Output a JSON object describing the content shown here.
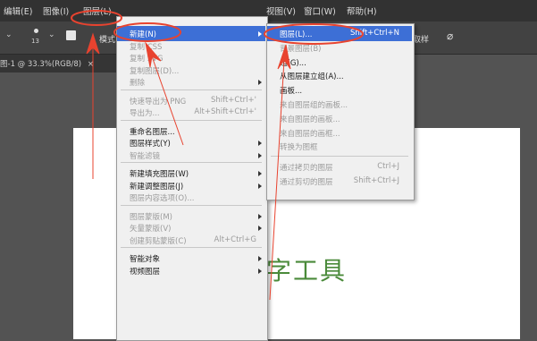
{
  "menubar": {
    "left_items": [
      "编辑(E)",
      "图像(I)",
      "图层(L)"
    ],
    "right_items": [
      "视图(V)",
      "窗口(W)",
      "帮助(H)"
    ]
  },
  "options": {
    "brush_size": "13",
    "mode_label": "模式",
    "right_label": "取样"
  },
  "doc_tab": {
    "label": "图-1 @ 33.3%(RGB/8)",
    "close": "×"
  },
  "canvas_text": "字工具",
  "layer_menu": [
    {
      "label": "新建(N)",
      "shortcut": "",
      "submenu": true,
      "state": "highlight"
    },
    {
      "label": "复制 CSS",
      "shortcut": "",
      "submenu": false,
      "state": "disabled"
    },
    {
      "label": "复制 SVG",
      "shortcut": "",
      "submenu": false,
      "state": "disabled"
    },
    {
      "label": "复制图层(D)...",
      "shortcut": "",
      "submenu": false,
      "state": "disabled"
    },
    {
      "label": "删除",
      "shortcut": "",
      "submenu": true,
      "state": "disabled"
    },
    {
      "sep": true
    },
    {
      "label": "快速导出为 PNG",
      "shortcut": "Shift+Ctrl+'",
      "submenu": false,
      "state": "disabled"
    },
    {
      "label": "导出为...",
      "shortcut": "Alt+Shift+Ctrl+'",
      "submenu": false,
      "state": "disabled"
    },
    {
      "sep": true
    },
    {
      "label": "重命名图层...",
      "shortcut": "",
      "submenu": false,
      "state": "normal"
    },
    {
      "label": "图层样式(Y)",
      "shortcut": "",
      "submenu": true,
      "state": "normal"
    },
    {
      "label": "智能滤镜",
      "shortcut": "",
      "submenu": true,
      "state": "disabled"
    },
    {
      "sep": true
    },
    {
      "label": "新建填充图层(W)",
      "shortcut": "",
      "submenu": true,
      "state": "normal"
    },
    {
      "label": "新建调整图层(J)",
      "shortcut": "",
      "submenu": true,
      "state": "normal"
    },
    {
      "label": "图层内容选项(O)...",
      "shortcut": "",
      "submenu": false,
      "state": "disabled"
    },
    {
      "sep": true
    },
    {
      "label": "图层蒙版(M)",
      "shortcut": "",
      "submenu": true,
      "state": "disabled"
    },
    {
      "label": "矢量蒙版(V)",
      "shortcut": "",
      "submenu": true,
      "state": "disabled"
    },
    {
      "label": "创建剪贴蒙版(C)",
      "shortcut": "Alt+Ctrl+G",
      "submenu": false,
      "state": "disabled"
    },
    {
      "sep": true
    },
    {
      "label": "智能对象",
      "shortcut": "",
      "submenu": true,
      "state": "normal"
    },
    {
      "label": "视频图层",
      "shortcut": "",
      "submenu": true,
      "state": "normal"
    }
  ],
  "new_submenu": [
    {
      "label": "图层(L)...",
      "shortcut": "Shift+Ctrl+N",
      "state": "highlight"
    },
    {
      "label": "背景图层(B)",
      "shortcut": "",
      "state": "disabled"
    },
    {
      "label": "组(G)...",
      "shortcut": "",
      "state": "normal"
    },
    {
      "label": "从图层建立组(A)...",
      "shortcut": "",
      "state": "normal"
    },
    {
      "label": "画板...",
      "shortcut": "",
      "state": "normal"
    },
    {
      "label": "来自图层组的画板...",
      "shortcut": "",
      "state": "disabled"
    },
    {
      "label": "来自图层的画板...",
      "shortcut": "",
      "state": "disabled"
    },
    {
      "label": "来自图层的画框...",
      "shortcut": "",
      "state": "disabled"
    },
    {
      "label": "转换为图框",
      "shortcut": "",
      "state": "disabled"
    },
    {
      "sep": true
    },
    {
      "label": "通过拷贝的图层",
      "shortcut": "Ctrl+J",
      "state": "disabled"
    },
    {
      "label": "通过剪切的图层",
      "shortcut": "Shift+Ctrl+J",
      "state": "disabled"
    }
  ],
  "annotation_color": "#e8432f"
}
